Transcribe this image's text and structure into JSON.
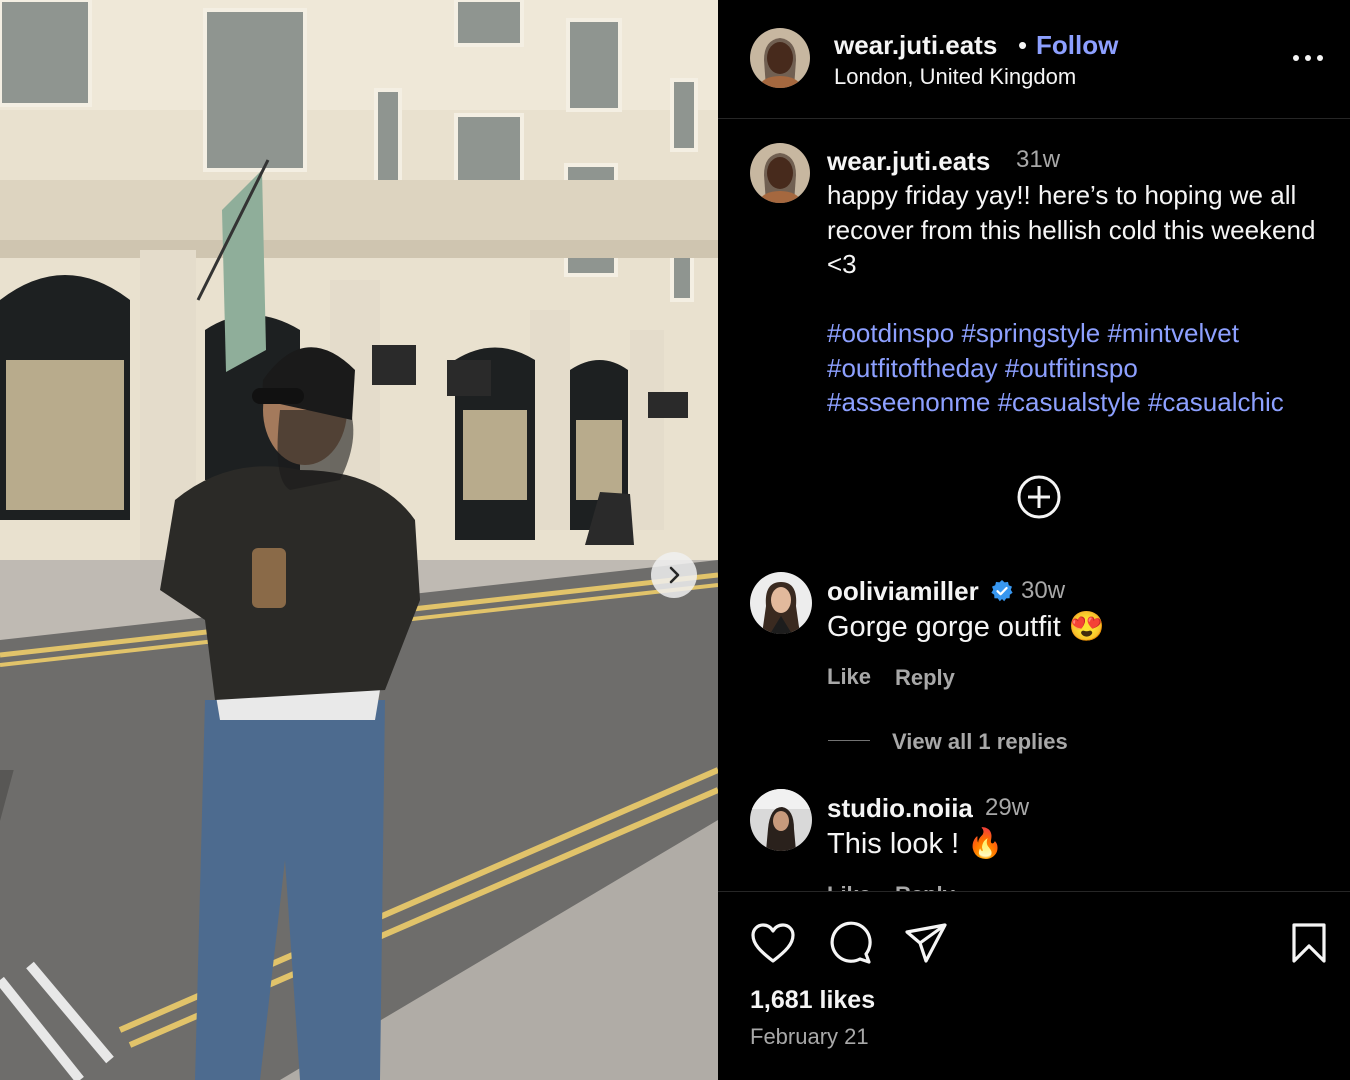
{
  "post": {
    "username": "wear.juti.eats",
    "follow_label": "Follow",
    "location": "London, United Kingdom",
    "caption_time": "31w",
    "caption_text": "happy friday yay!! here’s to hoping we all recover from this hellish cold this weekend <3",
    "hashtags": [
      "#ootdinspo",
      "#springstyle",
      "#mintvelvet",
      "#outfitoftheday",
      "#outfitinspo",
      "#asseenonme",
      "#casualstyle",
      "#casualchic"
    ],
    "likes": "1,681 likes",
    "date": "February 21"
  },
  "comments": [
    {
      "username": "ooliviamiller",
      "verified": true,
      "time": "30w",
      "text": "Gorge gorge outfit 😍",
      "like_label": "Like",
      "reply_label": "Reply",
      "view_replies": "View all 1 replies"
    },
    {
      "username": "studio.noiia",
      "verified": false,
      "time": "29w",
      "text": "This look ! 🔥",
      "like_label": "Like",
      "reply_label": "Reply"
    }
  ],
  "icons": {
    "more": "more-horizontal-icon",
    "next": "chevron-right-icon",
    "load_more": "plus-circle-icon",
    "like": "heart-icon",
    "comment": "comment-icon",
    "share": "paper-plane-icon",
    "save": "bookmark-icon",
    "verified": "verified-badge-icon"
  },
  "colors": {
    "background": "#000000",
    "link": "#8da0ff",
    "muted": "#a8a8a8",
    "verified": "#3897f0"
  }
}
